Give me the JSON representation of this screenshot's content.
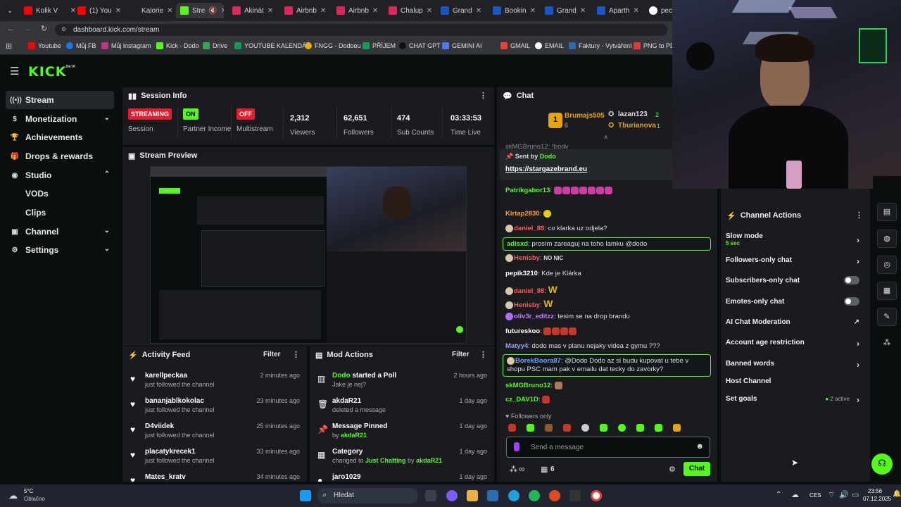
{
  "browser": {
    "tabs": [
      {
        "label": "Kolik V"
      },
      {
        "label": "(1) You"
      },
      {
        "label": "Kalorie"
      },
      {
        "label": "Stre"
      },
      {
        "label": "Akinát"
      },
      {
        "label": "Airbnb"
      },
      {
        "label": "Airbnb"
      },
      {
        "label": "Chalup"
      },
      {
        "label": "Grand"
      },
      {
        "label": "Bookin"
      },
      {
        "label": "Grand"
      },
      {
        "label": "Aparth"
      },
      {
        "label": "pec p"
      }
    ],
    "url": "dashboard.kick.com/stream",
    "bookmarks": [
      "Youtube",
      "Můj FB",
      "Můj instagram",
      "Kick - Dodo",
      "Drive",
      "YOUTUBE KALENDÁŘ",
      "FNGG - Dodoeu",
      "PŘÍJEM",
      "CHAT GPT",
      "GEMINI AI",
      "GMAIL",
      "EMAIL",
      "Faktury - Vytváření",
      "PNG to PDF"
    ]
  },
  "brand": {
    "logo": "KICK",
    "beta": "BETA",
    "accent": "#53fc18"
  },
  "sidebar": {
    "items": [
      {
        "label": "Stream",
        "icon": "broadcast-icon"
      },
      {
        "label": "Monetization",
        "icon": "dollar-icon"
      },
      {
        "label": "Achievements",
        "icon": "trophy-icon"
      },
      {
        "label": "Drops & rewards",
        "icon": "gift-icon"
      },
      {
        "label": "Studio",
        "icon": "globe-icon"
      },
      {
        "label": "VODs"
      },
      {
        "label": "Clips"
      },
      {
        "label": "Channel",
        "icon": "channel-icon"
      },
      {
        "label": "Settings",
        "icon": "gear-icon"
      }
    ]
  },
  "session": {
    "title": "Session Info",
    "streaming_badge": "STREAMING",
    "session_label": "Session",
    "partner_badge": "ON",
    "partner_label": "Partner Income",
    "multistream_badge": "OFF",
    "multistream_label": "Multistream",
    "viewers": "2,312",
    "viewers_label": "Viewers",
    "followers": "62,651",
    "followers_label": "Followers",
    "subs": "474",
    "subs_label": "Sub Counts",
    "time": "03:33:53",
    "time_label": "Time Live"
  },
  "preview": {
    "title": "Stream Preview"
  },
  "activity": {
    "title": "Activity Feed",
    "filter": "Filter",
    "items": [
      {
        "name": "karellpeckaa",
        "sub": "just followed the channel",
        "time": "2 minutes ago"
      },
      {
        "name": "bananjablkokolac",
        "sub": "just followed the channel",
        "time": "23 minutes ago"
      },
      {
        "name": "D4viidek",
        "sub": "just followed the channel",
        "time": "25 minutes ago"
      },
      {
        "name": "placatykrecek1",
        "sub": "just followed the channel",
        "time": "33 minutes ago"
      },
      {
        "name": "Mates_kratv",
        "sub": "",
        "time": "34 minutes ago"
      }
    ]
  },
  "mod": {
    "title": "Mod Actions",
    "filter": "Filter",
    "items": [
      {
        "name_green": "Dodo",
        "name": "started a Poll",
        "sub": "Jake je nej?",
        "time": "2 hours ago"
      },
      {
        "name_green": "",
        "name": "akdaR21",
        "sub": "deleted a message",
        "time": "1 day ago"
      },
      {
        "name_green": "",
        "name": "Message Pinned",
        "sub_pre": "by ",
        "sub_green": "akdaR21",
        "time": "1 day ago"
      },
      {
        "name_green": "",
        "name": "Category",
        "sub_pre": "changed to ",
        "sub_green": "Just Chatting",
        "sub_mid": " by ",
        "sub_green2": "akdaR21",
        "time": "1 day ago"
      },
      {
        "name_green": "",
        "name": "jaro1029",
        "sub": "",
        "time": "1 day ago"
      }
    ]
  },
  "chat": {
    "title": "Chat",
    "leaderboard": {
      "first_name": "Brumajs505",
      "first_count": "6",
      "second_name": "lazan123",
      "second_count": "2",
      "third_name": "Tburianova",
      "third_count": "1"
    },
    "partial_top": "skMGBruno12: !body",
    "pinned": {
      "sent_by": "Sent by",
      "sender": "Dodo",
      "link": "https://stargazebrand.eu"
    },
    "messages": [
      {
        "user": "Patrikgabor13",
        "color": "#53fc18",
        "text": ""
      },
      {
        "user": "Kirtap2830",
        "color": "#f9a03f",
        "text": ""
      },
      {
        "user": "daniel_88",
        "color": "#ff5a5a",
        "text": "co klarka uz odjela?"
      },
      {
        "user": "adisxd",
        "color": "#53fc18",
        "text": "prosím zareaguj na toho lamku @dodo"
      },
      {
        "user": "Henisby",
        "color": "#ff5a5a",
        "text": "NO NIC"
      },
      {
        "user": "pepik3210",
        "color": "#ffffff",
        "text": "Kde je Klárka"
      },
      {
        "user": "daniel_88",
        "color": "#ff5a5a",
        "text": "W"
      },
      {
        "user": "Henisby",
        "color": "#ff5a5a",
        "text": "W"
      },
      {
        "user": "oliv3r_editzz",
        "color": "#c77dff",
        "text": "tesim se na drop brandu"
      },
      {
        "user": "futureskoo",
        "color": "#ffffff",
        "text": ""
      },
      {
        "user": "Matyy4",
        "color": "#a0a0ff",
        "text": "dodo mas v planu nejaky videa z gymu ???"
      },
      {
        "user": "BorekBoora87",
        "color": "#6aa7ff",
        "text": "@Dodo Dodo az si budu kupovat u tebe v shopu PSC mam pak v emailu dat tecky do zavorky?"
      },
      {
        "user": "skMGBruno12",
        "color": "#53fc18",
        "text": ""
      },
      {
        "user": "cz_DAV1D",
        "color": "#53fc18",
        "text": ""
      }
    ],
    "followers_only": "Followers only",
    "placeholder": "Send a message",
    "points": "∞",
    "gift_count": "6",
    "send": "Chat"
  },
  "channel_actions": {
    "title": "Channel Actions",
    "slow_mode": "Slow mode",
    "slow_value": "5 sec",
    "followers_only": "Followers-only chat",
    "subs_only": "Subscribers-only chat",
    "emotes_only": "Emotes-only chat",
    "ai_moderation": "AI Chat Moderation",
    "account_age": "Account age restriction",
    "banned_words": "Banned words",
    "host": "Host Channel",
    "goals": "Set goals",
    "goals_active": "2 active"
  },
  "taskbar": {
    "weather_temp": "5°C",
    "weather_desc": "Oblačno",
    "search": "Hledat",
    "lang": "CES",
    "time": "23:56",
    "date": "07.12.2025"
  }
}
